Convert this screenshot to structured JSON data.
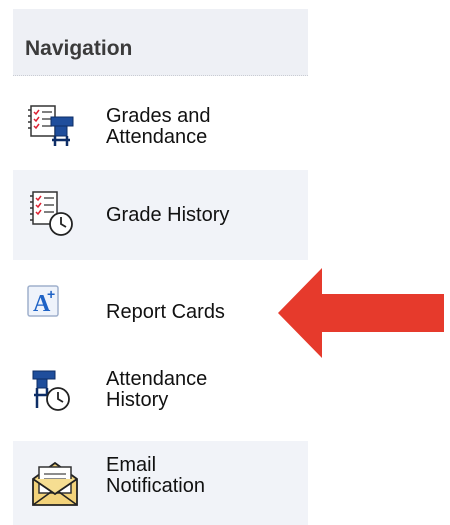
{
  "nav": {
    "title": "Navigation",
    "items": [
      {
        "label_line1": "Grades and",
        "label_line2": "Attendance",
        "icon": "grades-attendance-icon"
      },
      {
        "label_line1": "Grade History",
        "label_line2": "",
        "icon": "grade-history-icon"
      },
      {
        "label_line1": "Report Cards",
        "label_line2": "",
        "icon": "report-card-icon",
        "icon_text": "A",
        "icon_sup": "+"
      },
      {
        "label_line1": "Attendance",
        "label_line2": "History",
        "icon": "attendance-history-icon"
      },
      {
        "label_line1": "Email",
        "label_line2": "Notification",
        "icon": "email-notification-icon"
      }
    ]
  },
  "annotation": {
    "arrow_color": "#e63a2c"
  }
}
